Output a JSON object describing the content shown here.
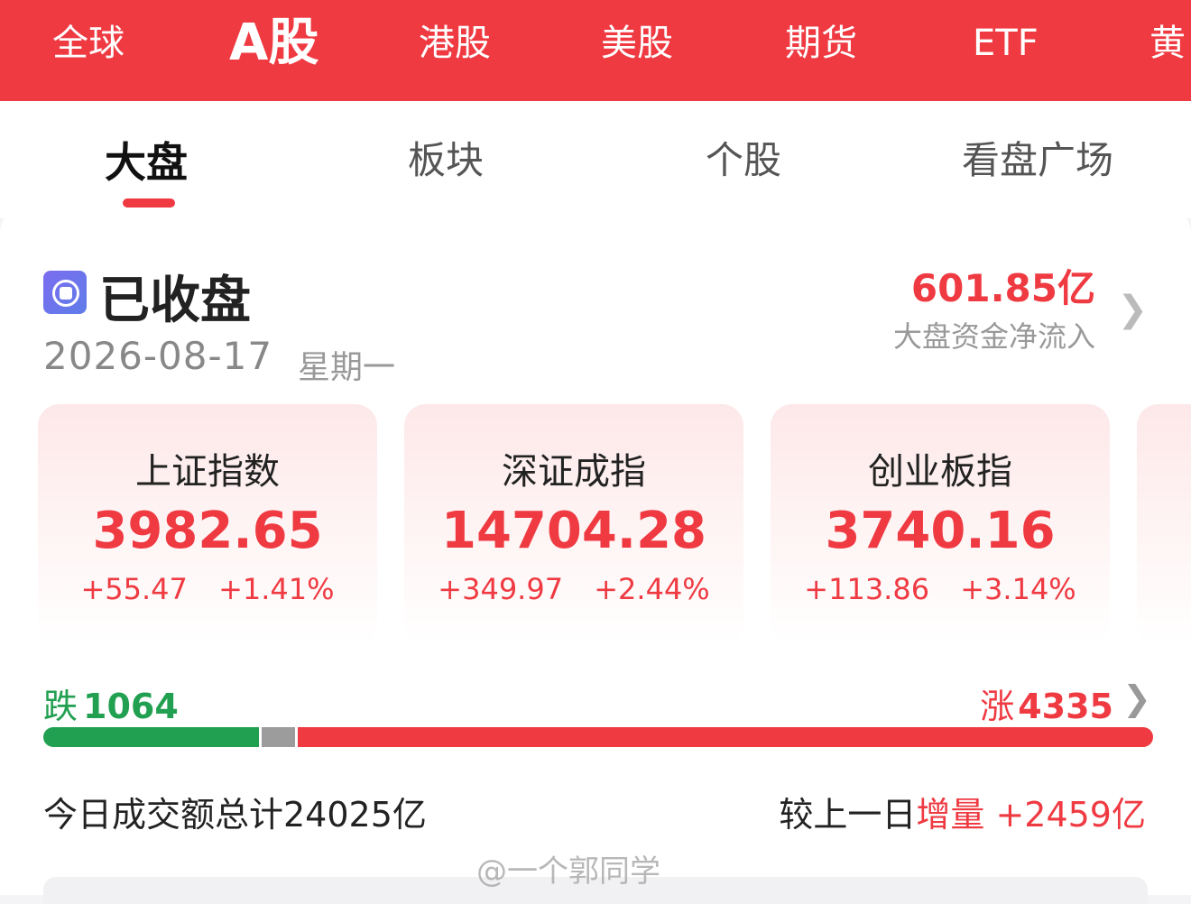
{
  "top_tabs": [
    "全球",
    "A股",
    "港股",
    "美股",
    "期货",
    "ETF",
    "黄"
  ],
  "top_active": "A股",
  "sub_tabs": [
    "大盘",
    "板块",
    "个股",
    "看盘广场"
  ],
  "sub_active": "大盘",
  "status": {
    "label": "已收盘",
    "date": "2026-08-17",
    "weekday": "星期一"
  },
  "capital_flow": {
    "value": "601.85亿",
    "label": "大盘资金净流入"
  },
  "indices": [
    {
      "name": "上证指数",
      "value": "3982.65",
      "change": "+55.47",
      "pct": "+1.41%"
    },
    {
      "name": "深证成指",
      "value": "14704.28",
      "change": "+349.97",
      "pct": "+2.44%"
    },
    {
      "name": "创业板指",
      "value": "3740.16",
      "change": "+113.86",
      "pct": "+3.14%"
    }
  ],
  "breadth": {
    "fall_label": "跌",
    "fall_count": "1064",
    "rise_label": "涨",
    "rise_count": "4335",
    "fall_fraction": 0.194,
    "flat_fraction": 0.03
  },
  "turnover": {
    "total_text": "今日成交额总计24025亿",
    "compare_prefix": "较上一日",
    "compare_value": "增量 +2459亿"
  },
  "watermark": "@一个郭同学",
  "colors": {
    "brand_red": "#ef3a42",
    "fall_green": "#22a052",
    "flat_gray": "#9c9c9c"
  }
}
